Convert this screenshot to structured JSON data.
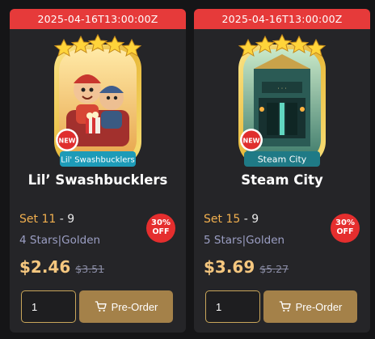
{
  "cards": [
    {
      "date": "2025-04-16T13:00:00Z",
      "sticker": {
        "icon": "sticker-lil-swashbucklers-icon",
        "banner": "Lil' Swashbucklers",
        "new_badge": "NEW",
        "stars": 5,
        "banner_color": "#1d9bb8",
        "frame_color": "#f3d154"
      },
      "title": "Lil’ Swashbucklers",
      "set_name": "Set 11",
      "set_sep": " - ",
      "set_num": "9",
      "stars_label": "4 Stars|Golden",
      "discount_pct": "30%",
      "discount_off": "OFF",
      "price": "$2.46",
      "old_price": "$3.51",
      "quantity": "1",
      "button_label": "Pre-Order"
    },
    {
      "date": "2025-04-16T13:00:00Z",
      "sticker": {
        "icon": "sticker-steam-city-icon",
        "banner": "Steam City",
        "new_badge": "NEW",
        "stars": 5,
        "banner_color": "#1f7a86",
        "frame_color": "#f3d154"
      },
      "title": "Steam City",
      "set_name": "Set 15",
      "set_sep": " - ",
      "set_num": "9",
      "stars_label": "5 Stars|Golden",
      "discount_pct": "30%",
      "discount_off": "OFF",
      "price": "$3.69",
      "old_price": "$5.27",
      "quantity": "1",
      "button_label": "Pre-Order"
    }
  ],
  "colors": {
    "background": "#151517",
    "card": "#252528",
    "date_bar": "#e63a3a",
    "accent_gold": "#a48149",
    "price": "#f5c77f",
    "set_name": "#f2b04f",
    "muted": "#9c9fc4"
  }
}
